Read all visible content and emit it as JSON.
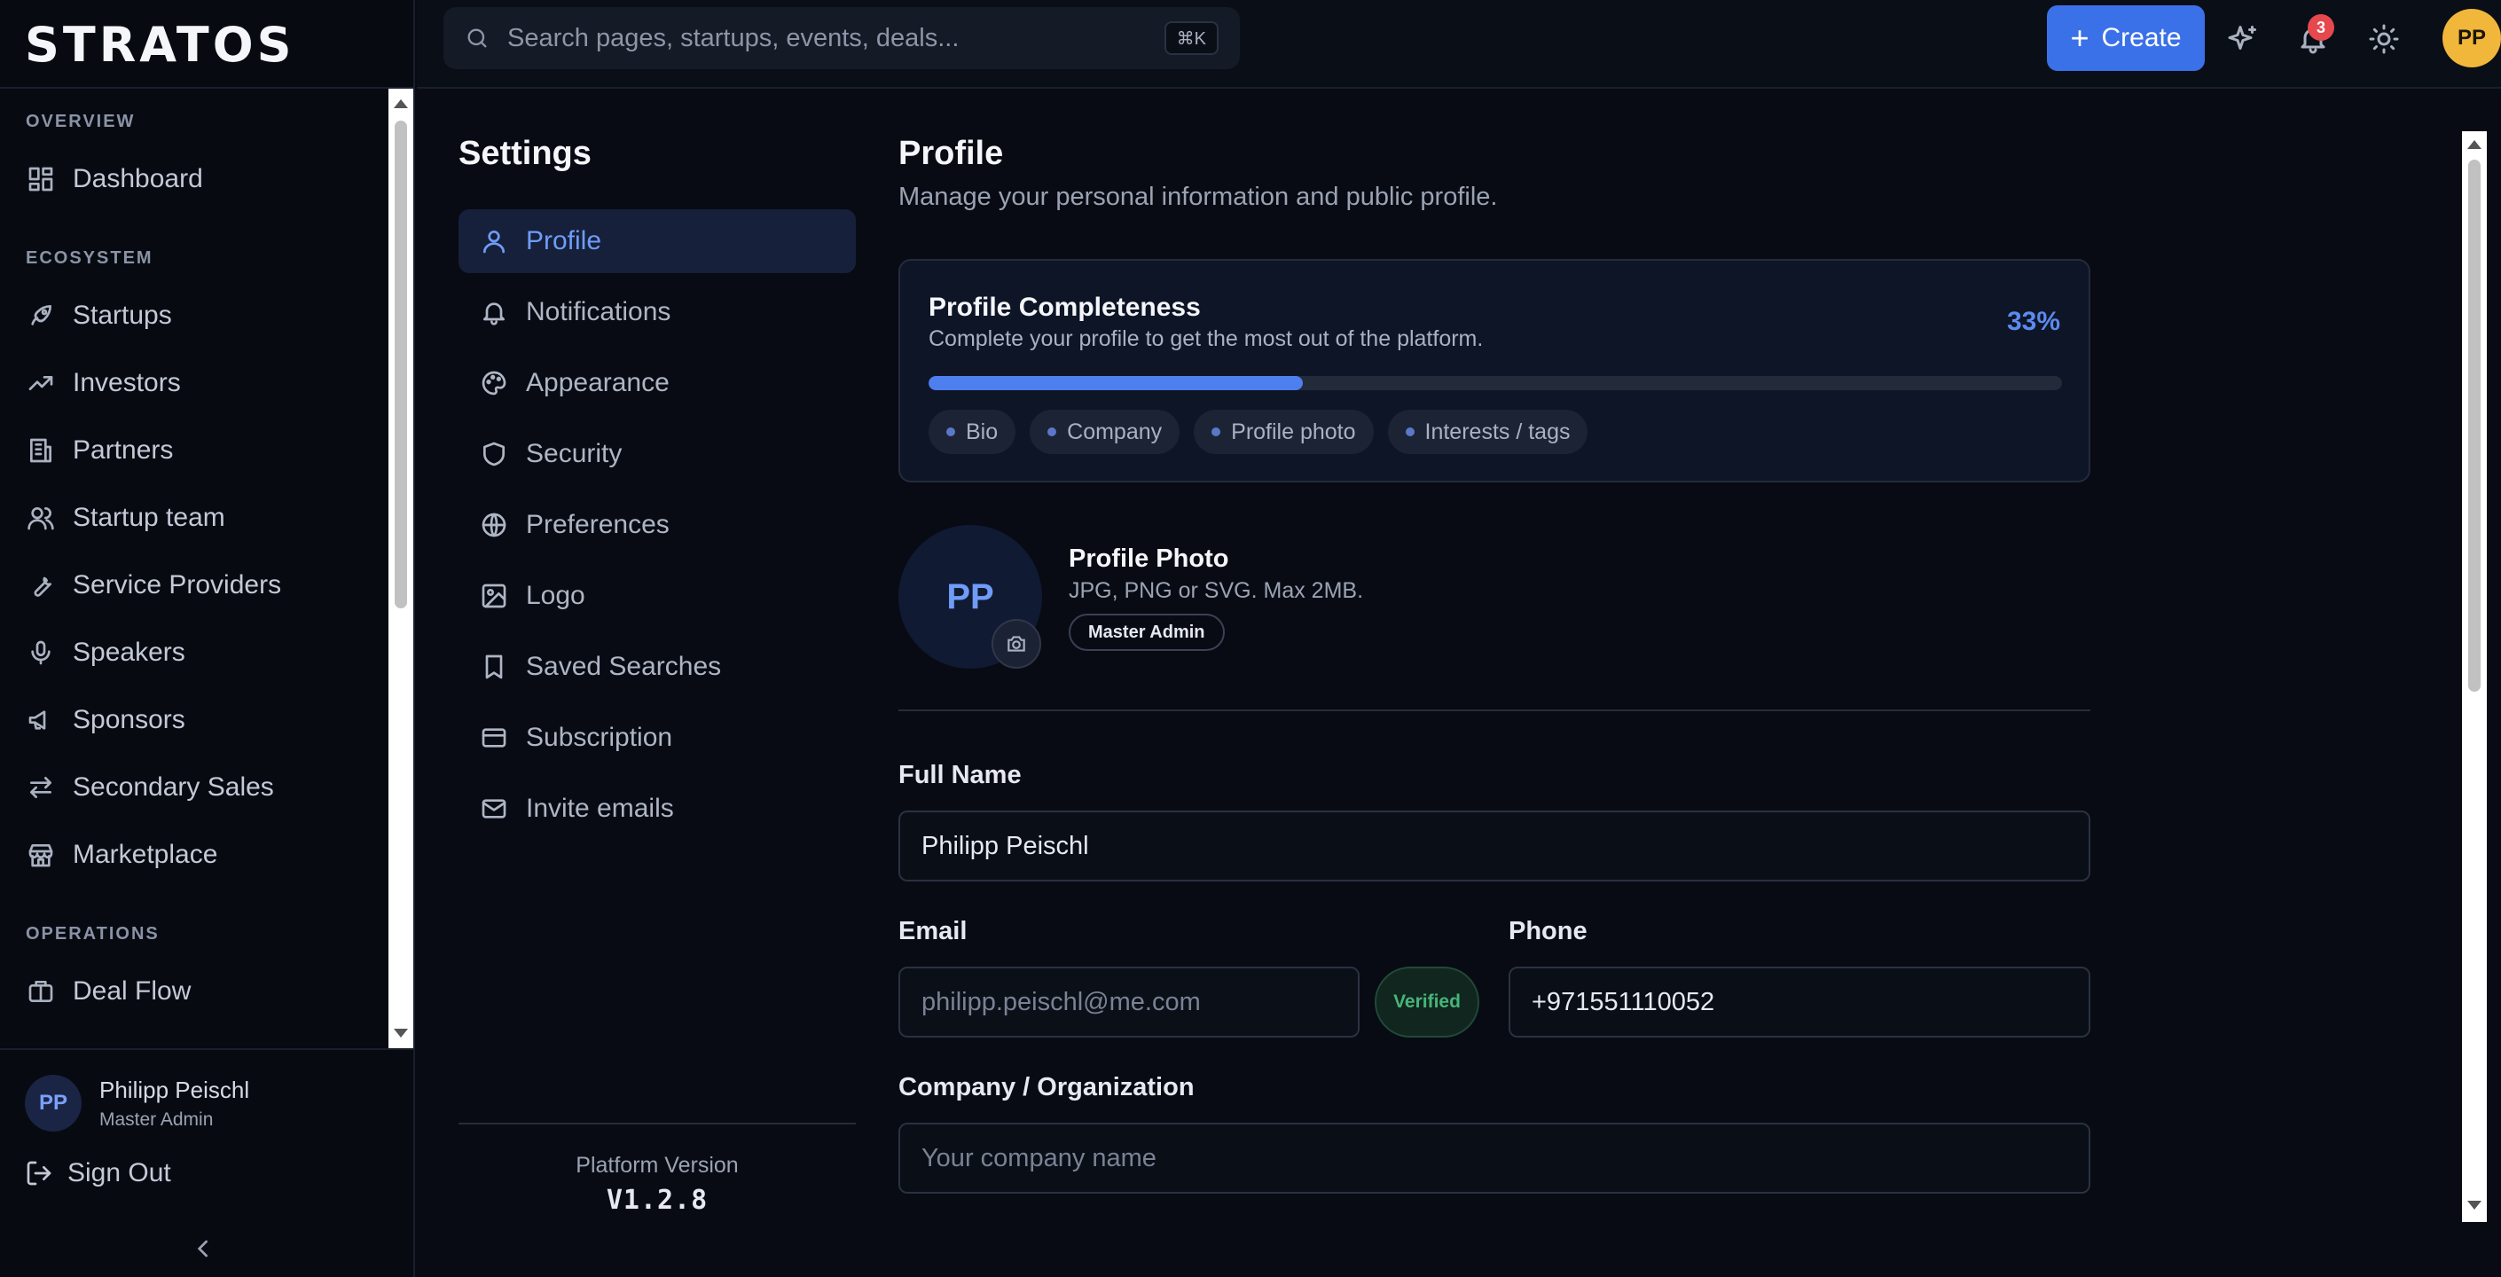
{
  "brand": "STRATOS",
  "sidebar": {
    "sections": [
      {
        "label": "OVERVIEW",
        "items": [
          {
            "label": "Dashboard",
            "icon": "dashboard-icon"
          }
        ]
      },
      {
        "label": "ECOSYSTEM",
        "items": [
          {
            "label": "Startups",
            "icon": "rocket-icon"
          },
          {
            "label": "Investors",
            "icon": "trending-up-icon"
          },
          {
            "label": "Partners",
            "icon": "building-icon"
          },
          {
            "label": "Startup team",
            "icon": "users-icon"
          },
          {
            "label": "Service Providers",
            "icon": "wrench-icon"
          },
          {
            "label": "Speakers",
            "icon": "microphone-icon"
          },
          {
            "label": "Sponsors",
            "icon": "megaphone-icon"
          },
          {
            "label": "Secondary Sales",
            "icon": "swap-arrows-icon"
          },
          {
            "label": "Marketplace",
            "icon": "store-icon"
          }
        ]
      },
      {
        "label": "OPERATIONS",
        "items": [
          {
            "label": "Deal Flow",
            "icon": "briefcase-icon"
          }
        ]
      }
    ],
    "user": {
      "initials": "PP",
      "name": "Philipp Peischl",
      "role": "Master Admin"
    },
    "sign_out": "Sign Out"
  },
  "topbar": {
    "search_placeholder": "Search pages, startups, events, deals...",
    "shortcut": "⌘K",
    "create_label": "Create",
    "notification_count": "3",
    "avatar_initials": "PP"
  },
  "settings_nav": {
    "title": "Settings",
    "items": [
      {
        "label": "Profile",
        "icon": "user-icon",
        "active": true
      },
      {
        "label": "Notifications",
        "icon": "bell-icon"
      },
      {
        "label": "Appearance",
        "icon": "palette-icon"
      },
      {
        "label": "Security",
        "icon": "shield-icon"
      },
      {
        "label": "Preferences",
        "icon": "globe-icon"
      },
      {
        "label": "Logo",
        "icon": "image-icon"
      },
      {
        "label": "Saved Searches",
        "icon": "bookmark-icon"
      },
      {
        "label": "Subscription",
        "icon": "credit-card-icon"
      },
      {
        "label": "Invite emails",
        "icon": "mail-icon"
      }
    ],
    "version_label": "Platform Version",
    "version_value": "V1.2.8"
  },
  "profile": {
    "title": "Profile",
    "subtitle": "Manage your personal information and public profile.",
    "completeness": {
      "title": "Profile Completeness",
      "subtitle": "Complete your profile to get the most out of the platform.",
      "percent_label": "33%",
      "percent": 33,
      "missing": [
        "Bio",
        "Company",
        "Profile photo",
        "Interests / tags"
      ]
    },
    "photo": {
      "initials": "PP",
      "title": "Profile Photo",
      "hint": "JPG, PNG or SVG. Max 2MB.",
      "role_badge": "Master Admin"
    },
    "fields": {
      "full_name_label": "Full Name",
      "full_name_value": "Philipp Peischl",
      "email_label": "Email",
      "email_value": "philipp.peischl@me.com",
      "email_status": "Verified",
      "phone_label": "Phone",
      "phone_value": "+971551110052",
      "company_label": "Company / Organization",
      "company_placeholder": "Your company name"
    }
  },
  "colors": {
    "accent": "#3b71e8",
    "progress": "#4d7fee",
    "badge": "#e5484d",
    "avatar": "#f0b73a",
    "verified": "#46b57a"
  }
}
